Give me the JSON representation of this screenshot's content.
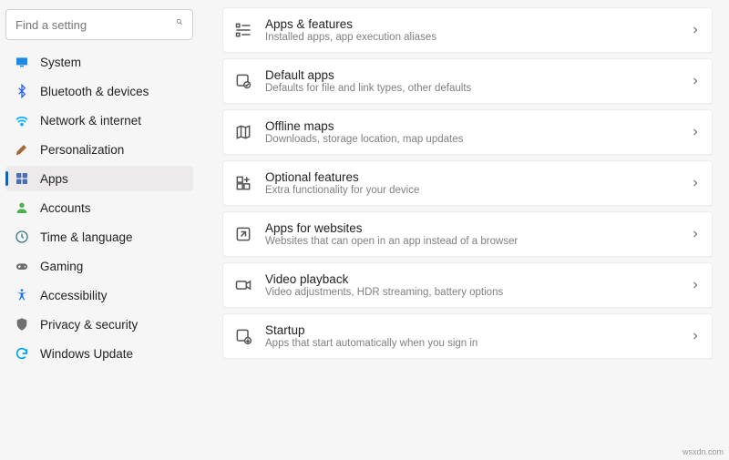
{
  "search": {
    "placeholder": "Find a setting"
  },
  "sidebar": {
    "items": [
      {
        "label": "System",
        "icon": "system-icon",
        "color": "#1e88e5"
      },
      {
        "label": "Bluetooth & devices",
        "icon": "bluetooth-icon",
        "color": "#2962ff"
      },
      {
        "label": "Network & internet",
        "icon": "network-icon",
        "color": "#00b0ff"
      },
      {
        "label": "Personalization",
        "icon": "personalization-icon",
        "color": "#a06a3a"
      },
      {
        "label": "Apps",
        "icon": "apps-icon",
        "color": "#4a6fb5",
        "selected": true
      },
      {
        "label": "Accounts",
        "icon": "accounts-icon",
        "color": "#4caf50"
      },
      {
        "label": "Time & language",
        "icon": "time-language-icon",
        "color": "#3a7a8a"
      },
      {
        "label": "Gaming",
        "icon": "gaming-icon",
        "color": "#6d6d6d"
      },
      {
        "label": "Accessibility",
        "icon": "accessibility-icon",
        "color": "#1a73e8"
      },
      {
        "label": "Privacy & security",
        "icon": "privacy-security-icon",
        "color": "#707070"
      },
      {
        "label": "Windows Update",
        "icon": "windows-update-icon",
        "color": "#00a4ef"
      }
    ]
  },
  "main": {
    "cards": [
      {
        "title": "Apps & features",
        "subtitle": "Installed apps, app execution aliases",
        "icon": "apps-features-icon"
      },
      {
        "title": "Default apps",
        "subtitle": "Defaults for file and link types, other defaults",
        "icon": "default-apps-icon"
      },
      {
        "title": "Offline maps",
        "subtitle": "Downloads, storage location, map updates",
        "icon": "offline-maps-icon"
      },
      {
        "title": "Optional features",
        "subtitle": "Extra functionality for your device",
        "icon": "optional-features-icon"
      },
      {
        "title": "Apps for websites",
        "subtitle": "Websites that can open in an app instead of a browser",
        "icon": "apps-websites-icon"
      },
      {
        "title": "Video playback",
        "subtitle": "Video adjustments, HDR streaming, battery options",
        "icon": "video-playback-icon"
      },
      {
        "title": "Startup",
        "subtitle": "Apps that start automatically when you sign in",
        "icon": "startup-icon"
      }
    ]
  },
  "watermark": "wsxdn.com"
}
